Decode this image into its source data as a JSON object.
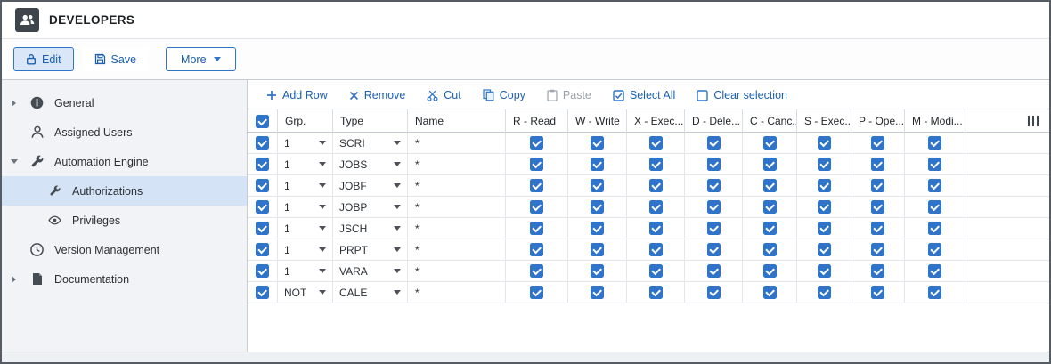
{
  "window": {
    "title": "DEVELOPERS"
  },
  "action_bar": {
    "edit": "Edit",
    "save": "Save",
    "more": "More"
  },
  "sidebar": {
    "items": [
      {
        "label": "General",
        "icon": "info-icon",
        "expanded": false,
        "level": 0,
        "selected": false
      },
      {
        "label": "Assigned Users",
        "icon": "user-icon",
        "level": 0,
        "selected": false
      },
      {
        "label": "Automation Engine",
        "icon": "wrench-icon",
        "expanded": true,
        "level": 0,
        "selected": false
      },
      {
        "label": "Authorizations",
        "icon": "wrench-icon",
        "level": 1,
        "selected": true
      },
      {
        "label": "Privileges",
        "icon": "eye-icon",
        "level": 1,
        "selected": false
      },
      {
        "label": "Version Management",
        "icon": "clock-icon",
        "level": 0,
        "selected": false
      },
      {
        "label": "Documentation",
        "icon": "document-icon",
        "expanded": false,
        "level": 0,
        "selected": false
      }
    ]
  },
  "grid_toolbar": {
    "add_row": "Add Row",
    "remove": "Remove",
    "cut": "Cut",
    "copy": "Copy",
    "paste": "Paste",
    "paste_enabled": false,
    "select_all": "Select All",
    "clear_selection": "Clear selection"
  },
  "grid": {
    "all_selected": true,
    "columns": {
      "grp": "Grp.",
      "type": "Type",
      "name": "Name",
      "perms": [
        "R - Read",
        "W - Write",
        "X - Exec...",
        "D - Dele...",
        "C - Canc...",
        "S - Exec...",
        "P - Ope...",
        "M - Modi..."
      ]
    },
    "rows": [
      {
        "selected": true,
        "grp": "1",
        "type": "SCRI",
        "name": "*",
        "perms": [
          true,
          true,
          true,
          true,
          true,
          true,
          true,
          true
        ]
      },
      {
        "selected": true,
        "grp": "1",
        "type": "JOBS",
        "name": "*",
        "perms": [
          true,
          true,
          true,
          true,
          true,
          true,
          true,
          true
        ]
      },
      {
        "selected": true,
        "grp": "1",
        "type": "JOBF",
        "name": "*",
        "perms": [
          true,
          true,
          true,
          true,
          true,
          true,
          true,
          true
        ]
      },
      {
        "selected": true,
        "grp": "1",
        "type": "JOBP",
        "name": "*",
        "perms": [
          true,
          true,
          true,
          true,
          true,
          true,
          true,
          true
        ]
      },
      {
        "selected": true,
        "grp": "1",
        "type": "JSCH",
        "name": "*",
        "perms": [
          true,
          true,
          true,
          true,
          true,
          true,
          true,
          true
        ]
      },
      {
        "selected": true,
        "grp": "1",
        "type": "PRPT",
        "name": "*",
        "perms": [
          true,
          true,
          true,
          true,
          true,
          true,
          true,
          true
        ]
      },
      {
        "selected": true,
        "grp": "1",
        "type": "VARA",
        "name": "*",
        "perms": [
          true,
          true,
          true,
          true,
          true,
          true,
          true,
          true
        ]
      },
      {
        "selected": true,
        "grp": "NOT",
        "type": "CALE",
        "name": "*",
        "perms": [
          true,
          true,
          true,
          true,
          true,
          true,
          true,
          true
        ]
      }
    ]
  },
  "icons": [
    "user-group-icon",
    "lock-icon",
    "floppy-icon",
    "chevron-down-icon",
    "info-icon",
    "user-icon",
    "wrench-icon",
    "eye-icon",
    "clock-icon",
    "document-icon",
    "plus-icon",
    "remove-x-icon",
    "scissors-icon",
    "copy-icon",
    "paste-icon",
    "checkbox-checked-icon",
    "checkbox-empty-icon",
    "column-settings-icon"
  ],
  "colors": {
    "accent_blue": "#2f74c9",
    "link_blue": "#1c5fae",
    "selected_nav_bg": "#d5e3f6",
    "sidebar_bg": "#f1f3f6",
    "header_icon_bg": "#3e454c"
  }
}
